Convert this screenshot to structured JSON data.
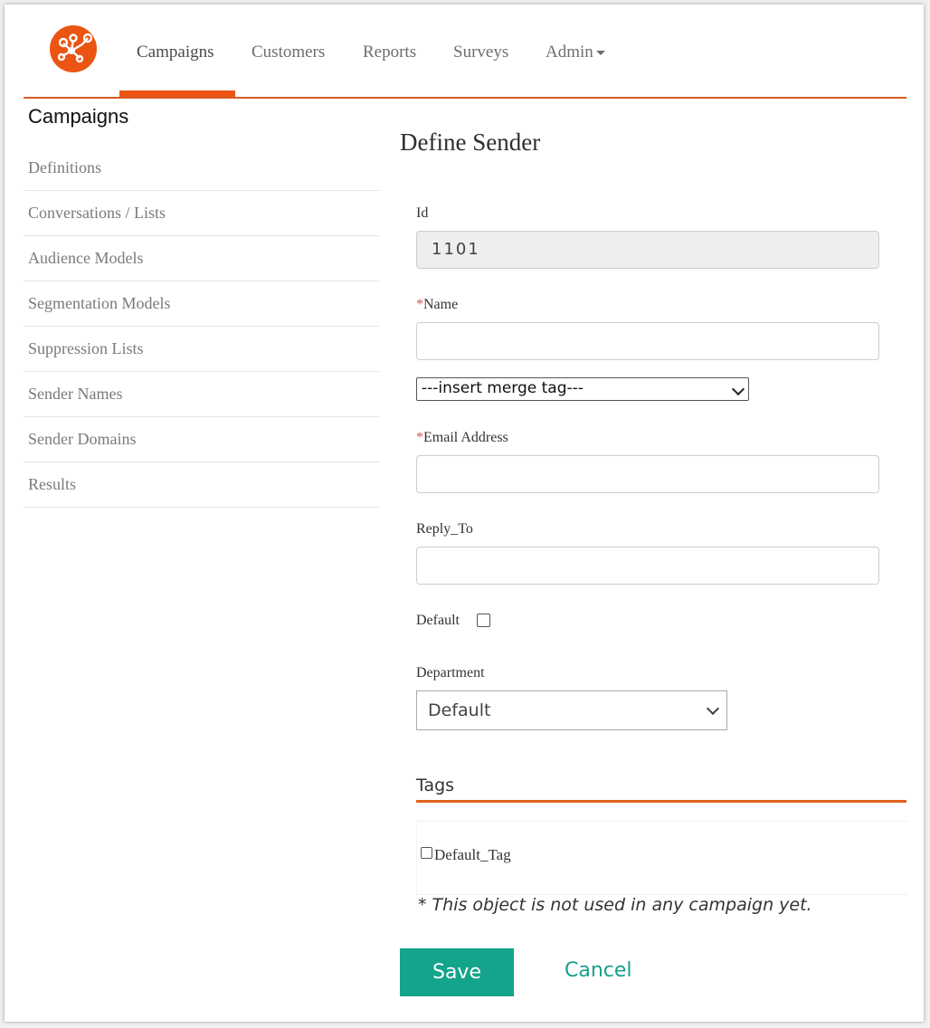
{
  "colors": {
    "brand_orange": "#ec5413",
    "accent_teal": "#14a38b",
    "required_red": "#d9534f"
  },
  "nav": {
    "logo_icon": "network-hub-icon",
    "items": [
      {
        "label": "Campaigns",
        "active": true
      },
      {
        "label": "Customers"
      },
      {
        "label": "Reports"
      },
      {
        "label": "Surveys"
      },
      {
        "label": "Admin",
        "dropdown": true
      }
    ]
  },
  "sidebar": {
    "title": "Campaigns",
    "items": [
      {
        "label": "Definitions"
      },
      {
        "label": "Conversations / Lists"
      },
      {
        "label": "Audience Models"
      },
      {
        "label": "Segmentation Models"
      },
      {
        "label": "Suppression Lists"
      },
      {
        "label": "Sender Names"
      },
      {
        "label": "Sender Domains"
      },
      {
        "label": "Results"
      }
    ]
  },
  "form": {
    "title": "Define Sender",
    "id": {
      "label": "Id",
      "value": "1101"
    },
    "name": {
      "required_mark": "*",
      "label": "Name",
      "value": ""
    },
    "merge_tag": {
      "selected": "---insert merge tag---"
    },
    "email": {
      "required_mark": "*",
      "label": "Email Address",
      "value": ""
    },
    "reply_to": {
      "label": "Reply_To",
      "value": ""
    },
    "default": {
      "label": "Default",
      "checked": false
    },
    "department": {
      "label": "Department",
      "selected": "Default"
    },
    "tags": {
      "title": "Tags",
      "items": [
        {
          "label": "Default_Tag",
          "checked": false
        }
      ]
    },
    "note": "* This object is not used in any campaign yet.",
    "save_label": "Save",
    "cancel_label": "Cancel"
  }
}
